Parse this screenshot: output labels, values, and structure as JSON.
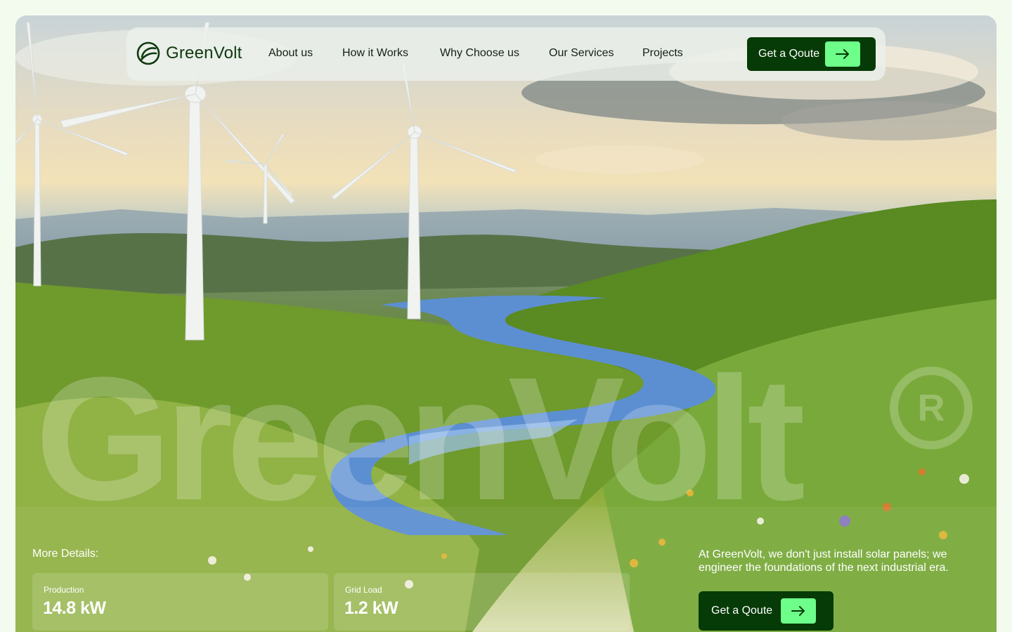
{
  "brand": {
    "name": "GreenVolt"
  },
  "nav": {
    "links": [
      "About us",
      "How it Works",
      "Why Choose us",
      "Our Services",
      "Projects"
    ],
    "cta_label": "Get a Qoute"
  },
  "hero": {
    "watermark": "GreenVolt",
    "registered_mark": "R",
    "details_title": "More Details:",
    "stats": [
      {
        "label": "Production",
        "value": "14.8 kW"
      },
      {
        "label": "Grid Load",
        "value": "1.2 kW"
      }
    ],
    "tagline": "At GreenVolt, we don't just install solar panels; we engineer the foundations of the next industrial era.",
    "cta_label": "Get a Qoute"
  },
  "colors": {
    "brand_dark": "#063a06",
    "accent": "#6dff8a",
    "page_bg": "#f3fbef"
  },
  "icons": {
    "logo": "leaf-swirl-logo-icon",
    "cta": "arrow-right-icon"
  }
}
